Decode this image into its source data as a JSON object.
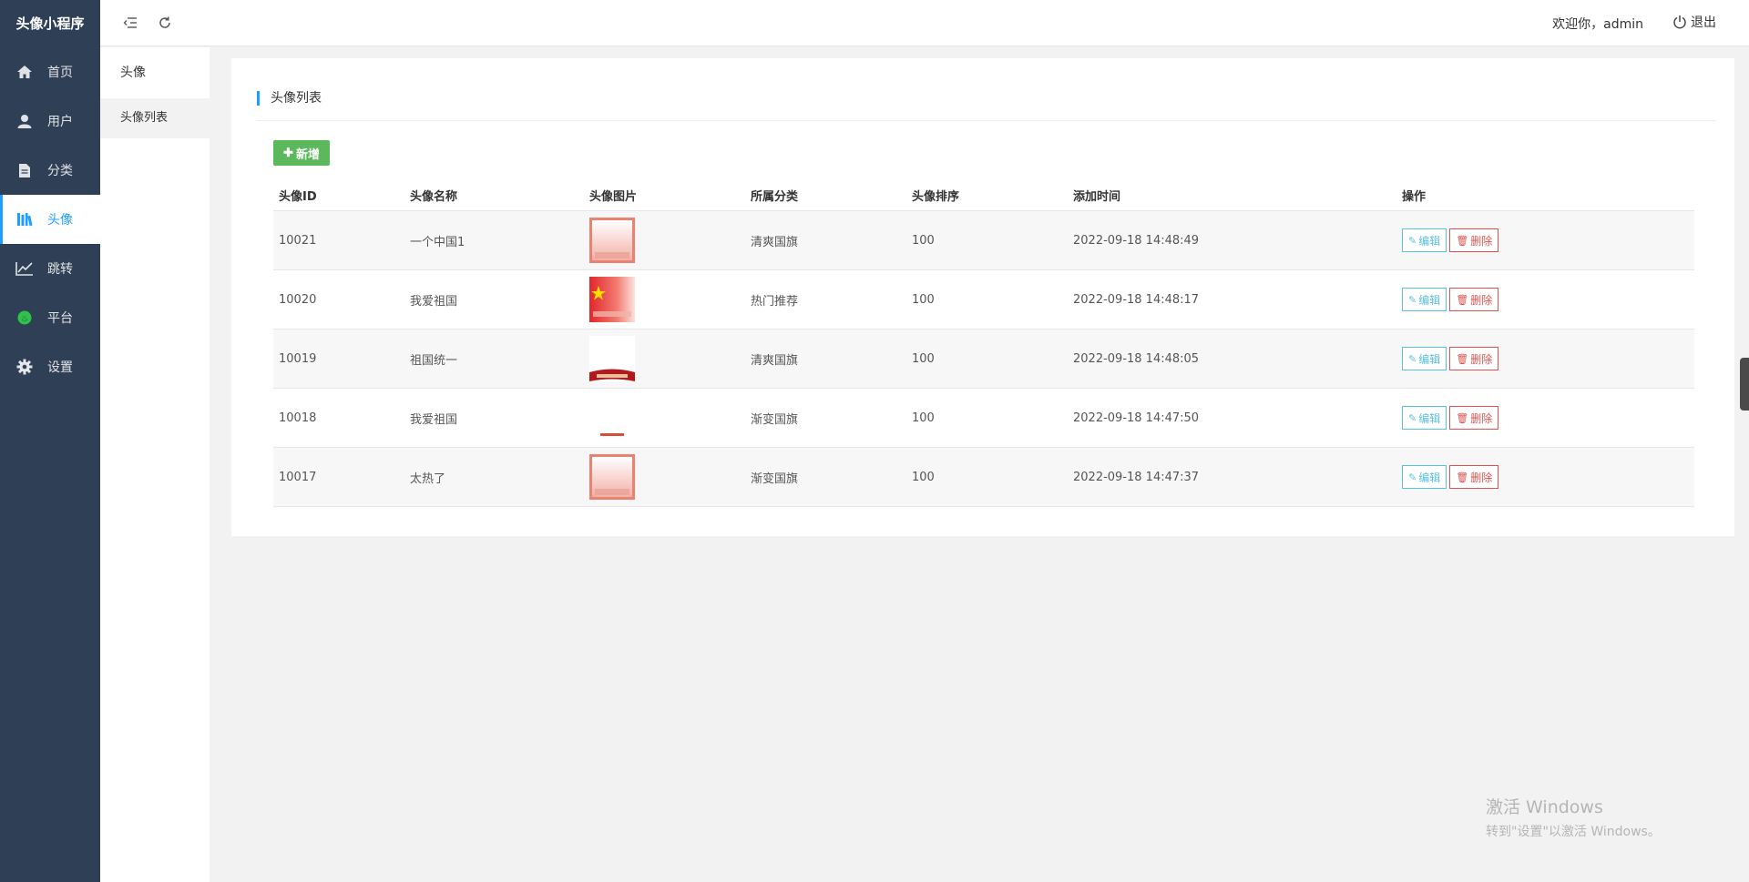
{
  "app": {
    "brand": "头像小程序"
  },
  "colors": {
    "sidebar_bg": "#2f4056",
    "accent": "#1e9fff",
    "add_btn": "#5cb85c",
    "edit": "#5bc0de",
    "delete": "#d9534f"
  },
  "sidebar": {
    "items": [
      {
        "label": "首页",
        "icon": "home-icon"
      },
      {
        "label": "用户",
        "icon": "user-icon"
      },
      {
        "label": "分类",
        "icon": "file-icon"
      },
      {
        "label": "头像",
        "icon": "book-icon",
        "active": true
      },
      {
        "label": "跳转",
        "icon": "line-chart-icon"
      },
      {
        "label": "平台",
        "icon": "platform-icon"
      },
      {
        "label": "设置",
        "icon": "gear-icon"
      }
    ]
  },
  "submenu": {
    "title": "头像",
    "items": [
      {
        "label": "头像列表"
      }
    ]
  },
  "header": {
    "welcome": "欢迎你，admin",
    "logout": "退出"
  },
  "main": {
    "title": "头像列表",
    "add_label": "新增",
    "columns": [
      "头像ID",
      "头像名称",
      "头像图片",
      "所属分类",
      "头像排序",
      "添加时间",
      "操作"
    ],
    "edit_label": "编辑",
    "delete_label": "删除",
    "rows": [
      {
        "id": "10021",
        "name": "一个中国1",
        "image": "frame",
        "category": "清爽国旗",
        "order": "100",
        "time": "2022-09-18 14:48:49"
      },
      {
        "id": "10020",
        "name": "我爱祖国",
        "image": "flag",
        "category": "热门推荐",
        "order": "100",
        "time": "2022-09-18 14:48:17"
      },
      {
        "id": "10019",
        "name": "祖国统一",
        "image": "banner",
        "category": "清爽国旗",
        "order": "100",
        "time": "2022-09-18 14:48:05"
      },
      {
        "id": "10018",
        "name": "我爱祖国",
        "image": "text",
        "category": "渐变国旗",
        "order": "100",
        "time": "2022-09-18 14:47:50"
      },
      {
        "id": "10017",
        "name": "太热了",
        "image": "frame",
        "category": "渐变国旗",
        "order": "100",
        "time": "2022-09-18 14:47:37"
      }
    ]
  },
  "watermark": {
    "line1": "激活 Windows",
    "line2": "转到\"设置\"以激活 Windows。"
  }
}
